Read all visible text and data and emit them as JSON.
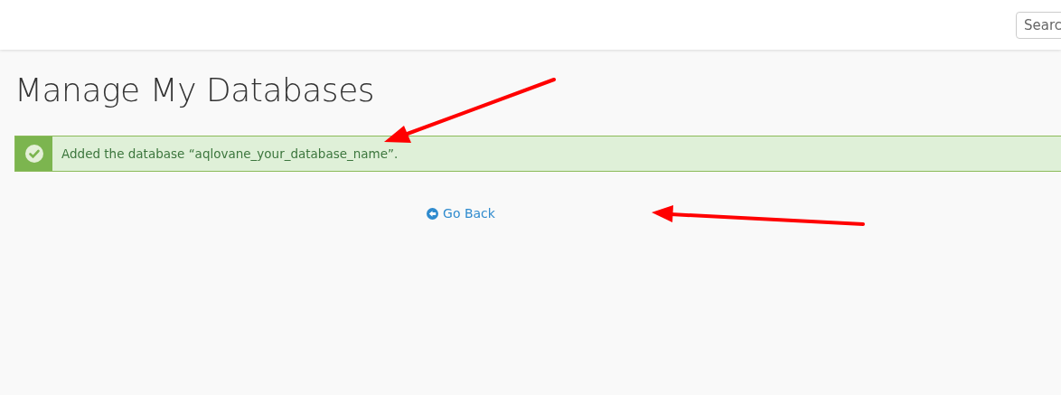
{
  "header": {
    "search": {
      "placeholder": "Searc"
    }
  },
  "page": {
    "title": "Manage My Databases"
  },
  "alert": {
    "kind": "success",
    "message": "Added the database “aqlovane_your_database_name”."
  },
  "go_back": {
    "label": "Go Back"
  }
}
